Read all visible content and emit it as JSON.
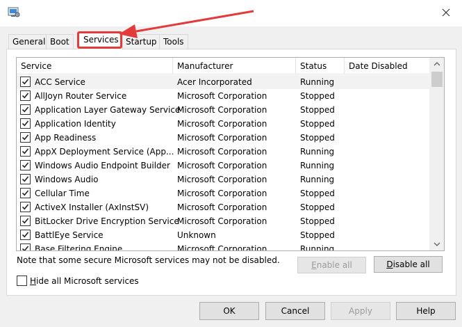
{
  "tabs": [
    {
      "label": "General"
    },
    {
      "label": "Boot"
    },
    {
      "label": "Services"
    },
    {
      "label": "Startup"
    },
    {
      "label": "Tools"
    }
  ],
  "active_tab": "Services",
  "columns": [
    "Service",
    "Manufacturer",
    "Status",
    "Date Disabled"
  ],
  "services": [
    {
      "name": "ACC Service",
      "manufacturer": "Acer Incorporated",
      "status": "Running",
      "date_disabled": "",
      "checked": true
    },
    {
      "name": "AllJoyn Router Service",
      "manufacturer": "Microsoft Corporation",
      "status": "Stopped",
      "date_disabled": "",
      "checked": true
    },
    {
      "name": "Application Layer Gateway Service",
      "manufacturer": "Microsoft Corporation",
      "status": "Stopped",
      "date_disabled": "",
      "checked": true
    },
    {
      "name": "Application Identity",
      "manufacturer": "Microsoft Corporation",
      "status": "Stopped",
      "date_disabled": "",
      "checked": true
    },
    {
      "name": "App Readiness",
      "manufacturer": "Microsoft Corporation",
      "status": "Stopped",
      "date_disabled": "",
      "checked": true
    },
    {
      "name": "AppX Deployment Service (App...",
      "manufacturer": "Microsoft Corporation",
      "status": "Running",
      "date_disabled": "",
      "checked": true
    },
    {
      "name": "Windows Audio Endpoint Builder",
      "manufacturer": "Microsoft Corporation",
      "status": "Running",
      "date_disabled": "",
      "checked": true
    },
    {
      "name": "Windows Audio",
      "manufacturer": "Microsoft Corporation",
      "status": "Running",
      "date_disabled": "",
      "checked": true
    },
    {
      "name": "Cellular Time",
      "manufacturer": "Microsoft Corporation",
      "status": "Stopped",
      "date_disabled": "",
      "checked": true
    },
    {
      "name": "ActiveX Installer (AxInstSV)",
      "manufacturer": "Microsoft Corporation",
      "status": "Stopped",
      "date_disabled": "",
      "checked": true
    },
    {
      "name": "BitLocker Drive Encryption Service",
      "manufacturer": "Microsoft Corporation",
      "status": "Stopped",
      "date_disabled": "",
      "checked": true
    },
    {
      "name": "BattlEye Service",
      "manufacturer": "Unknown",
      "status": "Stopped",
      "date_disabled": "",
      "checked": true
    },
    {
      "name": "Base Filtering Engine",
      "manufacturer": "Microsoft Corporation",
      "status": "Running",
      "date_disabled": "",
      "checked": true
    }
  ],
  "note": "Note that some secure Microsoft services may not be disabled.",
  "enable_all": {
    "accel": "E",
    "rest": "nable all"
  },
  "disable_all": {
    "accel": "D",
    "rest": "isable all"
  },
  "hide_ms": {
    "accel": "H",
    "rest": "ide all Microsoft services",
    "checked": false
  },
  "buttons": {
    "ok": "OK",
    "cancel": "Cancel",
    "apply": "Apply",
    "help": "Help"
  },
  "colors": {
    "highlight": "#e33b3b",
    "selected_row": "#f2f2f2"
  }
}
